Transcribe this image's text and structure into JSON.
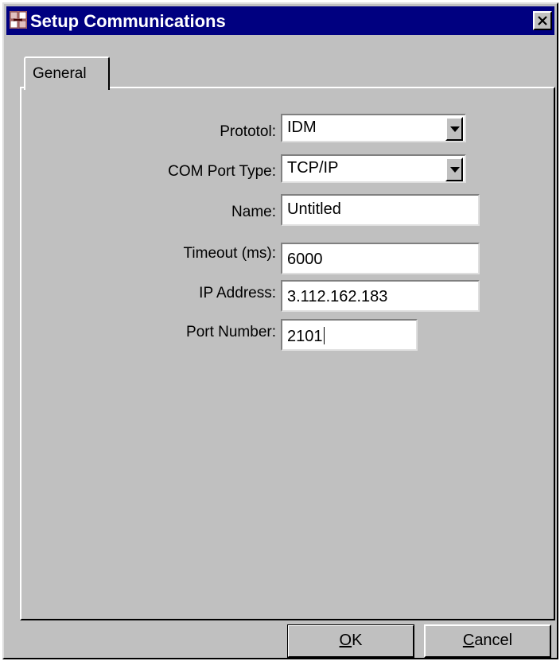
{
  "window": {
    "title": "Setup Communications",
    "icon": "app-icon",
    "close_icon": "close-icon"
  },
  "tabs": [
    {
      "label": "General",
      "active": true
    }
  ],
  "form": {
    "protocol": {
      "label": "Prototol:",
      "value": "IDM"
    },
    "com_port_type": {
      "label": "COM Port Type:",
      "value": "TCP/IP"
    },
    "name": {
      "label": "Name:",
      "value": "Untitled"
    },
    "timeout": {
      "label": "Timeout (ms):",
      "value": "6000"
    },
    "ip_address": {
      "label": "IP Address:",
      "value": "3.112.162.183"
    },
    "port_number": {
      "label": "Port Number:",
      "value": "2101"
    }
  },
  "buttons": {
    "ok": {
      "mnemonic": "O",
      "rest": "K"
    },
    "cancel": {
      "mnemonic": "C",
      "rest": "ancel"
    }
  },
  "colors": {
    "title_bar": "#000080",
    "dialog_face": "#c0c0c0"
  }
}
